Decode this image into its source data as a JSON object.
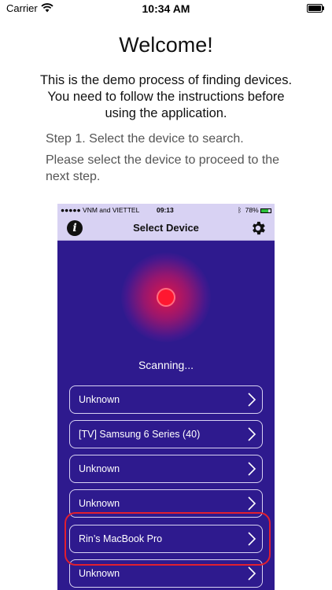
{
  "status_bar": {
    "carrier": "Carrier",
    "time": "10:34 AM"
  },
  "welcome": {
    "title": "Welcome!",
    "intro": "This is the demo process of finding devices. You need to follow the instructions before using the application."
  },
  "step": {
    "title": "Step 1. Select the device to search.",
    "description": "Please select the device to proceed to the next step."
  },
  "phone": {
    "status": {
      "carrier": "●●●●● VNM and VIETTEL",
      "time": "09:13",
      "battery": "78%"
    },
    "nav": {
      "title": "Select Device",
      "left_icon": "info-icon",
      "right_icon": "gear-icon"
    },
    "scanning_text": "Scanning...",
    "devices": [
      {
        "label": "Unknown"
      },
      {
        "label": "[TV] Samsung 6 Series (40)"
      },
      {
        "label": "Unknown"
      },
      {
        "label": "Unknown"
      },
      {
        "label": "Rin’s MacBook Pro"
      },
      {
        "label": "Unknown"
      }
    ]
  },
  "colors": {
    "phone_background": "#2e1a8e",
    "nav_background": "#d8d2f3",
    "radar": "#ff1730",
    "highlight": "#e11f2f"
  }
}
